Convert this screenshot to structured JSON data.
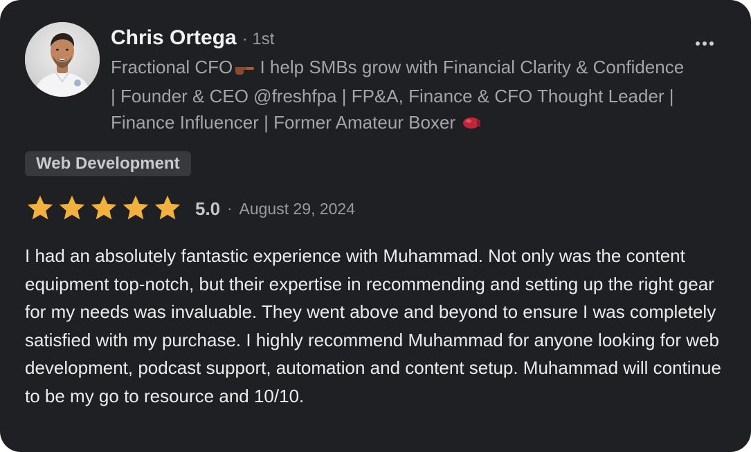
{
  "review": {
    "author": {
      "name": "Chris Ortega",
      "connection_degree": "· 1st",
      "headline_text": "Fractional CFO",
      "headline_emoji": "pointing-hand-icon",
      "headline_rest": " I help SMBs grow with Financial Clarity & Confidence | Founder & CEO @freshfpa | FP&A, Finance & CFO Thought Leader | Finance Influencer | Former Amateur Boxer ",
      "headline_end_emoji": "boxing-glove-icon"
    },
    "tag": "Web Development",
    "rating": {
      "stars": 5,
      "max_stars": 5,
      "score": "5.0",
      "separator": "·",
      "date": "August 29, 2024"
    },
    "body": "I had an absolutely fantastic experience with Muhammad. Not only was the content equipment top-notch, but their expertise in recommending and setting up the right gear for my needs was invaluable. They went above and beyond to ensure I was completely satisfied with my purchase. I highly recommend Muhammad for anyone looking for web development, podcast support, automation and content setup. Muhammad will continue to be my go to resource and 10/10."
  },
  "colors": {
    "card_background": "#1f2023",
    "star": "#f2b13c",
    "tag_background": "#37393d"
  }
}
